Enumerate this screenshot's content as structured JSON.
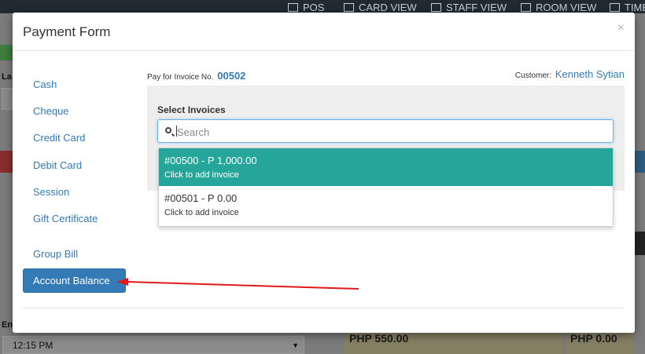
{
  "background": {
    "nav": [
      {
        "label": "POS"
      },
      {
        "label": "CARD VIEW"
      },
      {
        "label": "STAFF VIEW"
      },
      {
        "label": "ROOM VIEW"
      },
      {
        "label": "TIME"
      }
    ],
    "left_label_top": "La",
    "left_label_bottom": "En",
    "time_select": "12:15 PM",
    "total_1": "PHP 550.00",
    "total_2": "PHP 0.00"
  },
  "modal": {
    "title": "Payment Form",
    "close": "×",
    "methods": [
      {
        "label": "Cash"
      },
      {
        "label": "Cheque"
      },
      {
        "label": "Credit Card"
      },
      {
        "label": "Debit Card"
      },
      {
        "label": "Session"
      },
      {
        "label": "Gift Certificate"
      },
      {
        "label": "Group Bill"
      }
    ],
    "active_method": "Account Balance",
    "pay_for_label": "Pay for Invoice No.",
    "invoice_no": "00502",
    "customer_label": "Customer:",
    "customer_name": "Kenneth Sytian",
    "select_label": "Select Invoices",
    "search_placeholder": "Search",
    "invoices": [
      {
        "title": "#00500 - P 1,000.00",
        "subtitle": "Click to add invoice"
      },
      {
        "title": "#00501 - P 0.00",
        "subtitle": "Click to add invoice"
      }
    ]
  },
  "colors": {
    "accent": "#337ab7",
    "highlight": "#26a69a",
    "annotation_arrow": "#e01a1a"
  }
}
